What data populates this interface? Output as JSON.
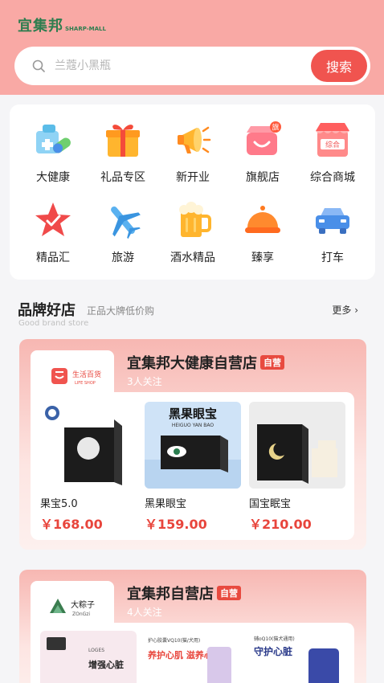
{
  "header": {
    "logo_main": "宜集邦",
    "logo_sub": "SHARP-MALL",
    "search_placeholder": "兰蔻小黑瓶",
    "search_button": "搜索"
  },
  "categories": [
    {
      "label": "大健康",
      "icon": "health-icon"
    },
    {
      "label": "礼品专区",
      "icon": "gift-icon"
    },
    {
      "label": "新开业",
      "icon": "megaphone-icon"
    },
    {
      "label": "旗舰店",
      "icon": "flagship-store-icon",
      "tag": "旗"
    },
    {
      "label": "综合商城",
      "icon": "mall-icon",
      "tag": "综合"
    },
    {
      "label": "精品汇",
      "icon": "star-icon"
    },
    {
      "label": "旅游",
      "icon": "airplane-icon"
    },
    {
      "label": "酒水精品",
      "icon": "beer-icon"
    },
    {
      "label": "臻享",
      "icon": "cloche-icon"
    },
    {
      "label": "打车",
      "icon": "car-icon"
    }
  ],
  "brand_section": {
    "title": "品牌好店",
    "subtitle": "正品大牌低价购",
    "english": "Good brand store",
    "more": "更多"
  },
  "stores": [
    {
      "name": "宜集邦大健康自营店",
      "badge": "自营",
      "followers": "3人关注",
      "logo_text": "生活百货",
      "logo_sub": "LIFE SHOP",
      "products": [
        {
          "name": "果宝5.0",
          "price": "￥168.00"
        },
        {
          "name": "黑果眼宝",
          "price": "￥159.00",
          "img_title": "黑果眼宝",
          "img_sub": "HEIGUO YAN BAO"
        },
        {
          "name": "国宝眠宝",
          "price": "￥210.00"
        }
      ]
    },
    {
      "name": "宜集邦自营店",
      "badge": "自营",
      "followers": "4人关注",
      "logo_text": "大粽子",
      "logo_sub": "ZOnGzi",
      "products": [
        {
          "img_title": "增强心脏",
          "img_sub": "LOGES"
        },
        {
          "img_title": "养护心肌 滋养心脏",
          "img_sub": "护心胶囊VQ10(猫/犬用)"
        },
        {
          "img_title": "守护心脏",
          "img_sub": "辅oQ10(猫犬通用)"
        }
      ]
    }
  ],
  "colors": {
    "header_bg": "#f9a9a5",
    "accent": "#f0544f",
    "price": "#e8453c",
    "logo_green": "#2e7d4f"
  }
}
